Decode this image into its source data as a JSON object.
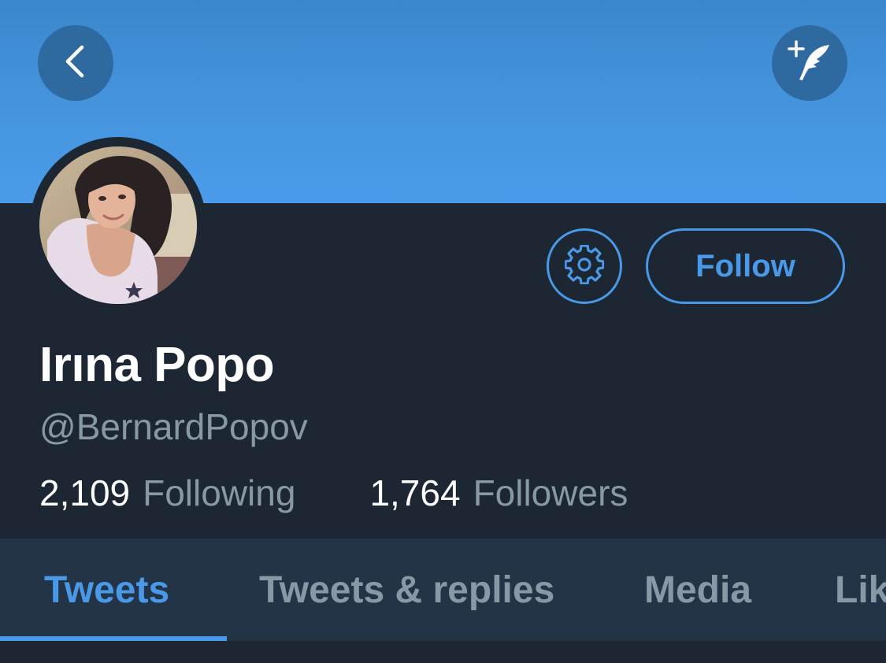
{
  "header": {
    "back_icon": "chevron-left-icon",
    "compose_icon": "compose-tweet-icon"
  },
  "profile": {
    "display_name": "Irına Popo",
    "handle": "@BernardPopov",
    "follow_label": "Follow",
    "settings_icon": "gear-icon",
    "stats": {
      "following_count": "2,109",
      "following_label": "Following",
      "followers_count": "1,764",
      "followers_label": "Followers"
    }
  },
  "tabs": [
    {
      "label": "Tweets",
      "active": true
    },
    {
      "label": "Tweets & replies",
      "active": false
    },
    {
      "label": "Media",
      "active": false
    },
    {
      "label": "Likes",
      "active": false
    }
  ],
  "colors": {
    "accent": "#4a99e9",
    "background": "#1c2733",
    "tab_bar": "#243447",
    "muted_text": "#8899a6"
  }
}
